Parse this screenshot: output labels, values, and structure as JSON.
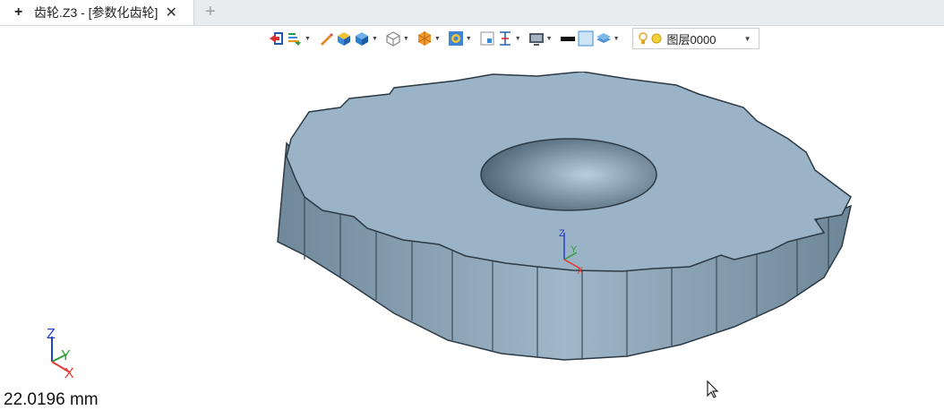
{
  "tab": {
    "title": "齿轮.Z3 - [参数化齿轮]",
    "plus_glyph": "+",
    "close_glyph": "✕",
    "new_tab_glyph": "+"
  },
  "toolbar": {
    "items": [
      "exit-icon",
      "filter-icon",
      "pencil-icon",
      "solid-color-icon",
      "box-shaded-icon",
      "box-wireframe-icon",
      "render-mode-icon",
      "view-fit-icon",
      "section-icon",
      "dimension-icon",
      "display-icon",
      "line-color-icon",
      "fill-color-icon",
      "layer-stack-icon"
    ],
    "layer_label": "图层0000"
  },
  "status": {
    "measure": "22.0196 mm"
  },
  "colors": {
    "gear_top": "#9ab3c6",
    "gear_side": "#7f98aa",
    "gear_dark": "#52697a",
    "tab_bar": "#e9ecef",
    "axis_x": "#e53935",
    "axis_y": "#2e9e3a",
    "axis_z": "#2340c8"
  }
}
